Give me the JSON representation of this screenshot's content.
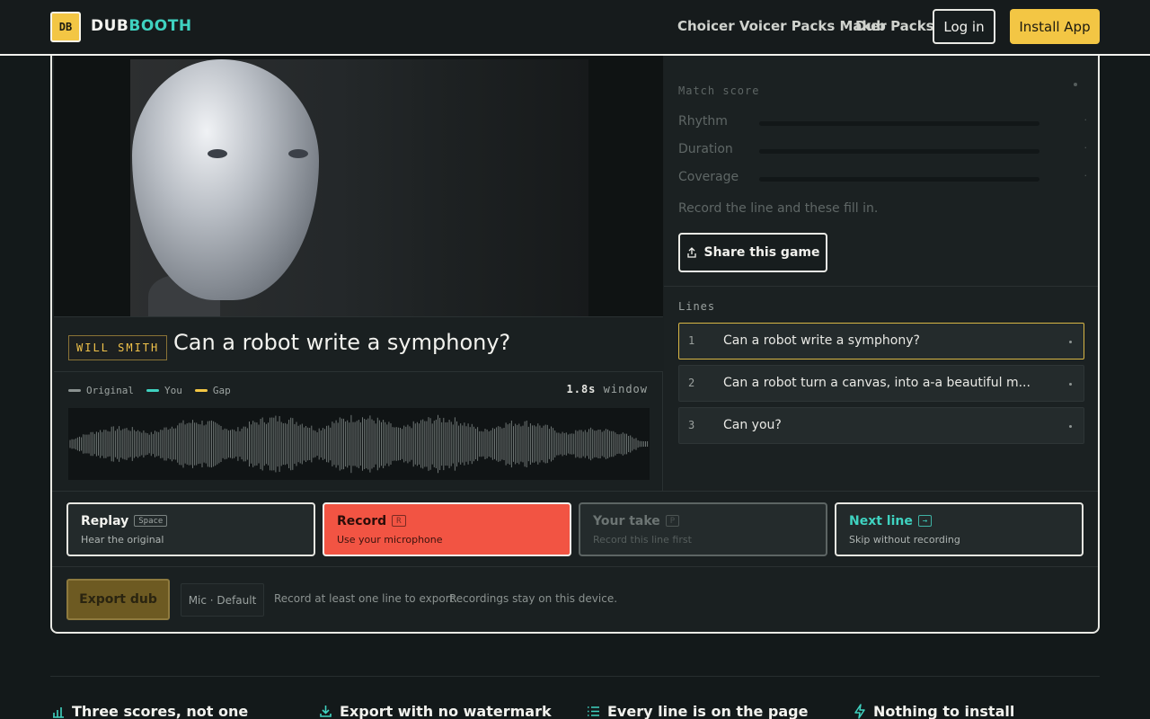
{
  "header": {
    "logo_mark": "DB",
    "logo_text_a": "DUB",
    "logo_text_b": "BOOTH",
    "nav": [
      "Choicer Voicer Packs Maker",
      "Dub Packs"
    ],
    "login_label": "Log in",
    "install_label": "Install App"
  },
  "clip": {
    "speaker": "WILL SMITH",
    "quote": "Can a robot write a symphony?"
  },
  "waveform": {
    "legend": [
      "Original",
      "You",
      "Gap"
    ],
    "legend_colors": [
      "#8a9190",
      "#3fd2c0",
      "#f3c644"
    ],
    "window_value": "1.8s",
    "window_unit": "window"
  },
  "match": {
    "heading": "Match score",
    "rows": [
      {
        "label": "Rhythm",
        "value": "·"
      },
      {
        "label": "Duration",
        "value": "·"
      },
      {
        "label": "Coverage",
        "value": "·"
      }
    ],
    "hint": "Record the line and these fill in.",
    "share_label": "Share this game"
  },
  "lines": {
    "heading": "Lines",
    "items": [
      {
        "num": "1",
        "text": "Can a robot write a symphony?"
      },
      {
        "num": "2",
        "text": "Can a robot turn a canvas, into a-a beautiful m..."
      },
      {
        "num": "3",
        "text": "Can you?"
      }
    ]
  },
  "controls": {
    "replay": {
      "title": "Replay",
      "key": "Space",
      "sub": "Hear the original"
    },
    "record": {
      "title": "Record",
      "key": "R",
      "sub": "Use your microphone"
    },
    "take": {
      "title": "Your take",
      "key": "P",
      "sub": "Record this line first"
    },
    "next": {
      "title": "Next line",
      "key": "→",
      "sub": "Skip without recording"
    }
  },
  "export": {
    "button": "Export dub",
    "mic": "Mic · Default",
    "note1": "Record at least one line to export.",
    "note2": "Recordings stay on this device."
  },
  "features": [
    {
      "icon": "bar-chart-icon",
      "text": "Three scores, not one"
    },
    {
      "icon": "download-icon",
      "text": "Export with no watermark"
    },
    {
      "icon": "list-icon",
      "text": "Every line is on the page"
    },
    {
      "icon": "bolt-icon",
      "text": "Nothing to install"
    }
  ],
  "colors": {
    "accent_yellow": "#f3c644",
    "accent_teal": "#3fd2c0",
    "record_red": "#f25443"
  }
}
